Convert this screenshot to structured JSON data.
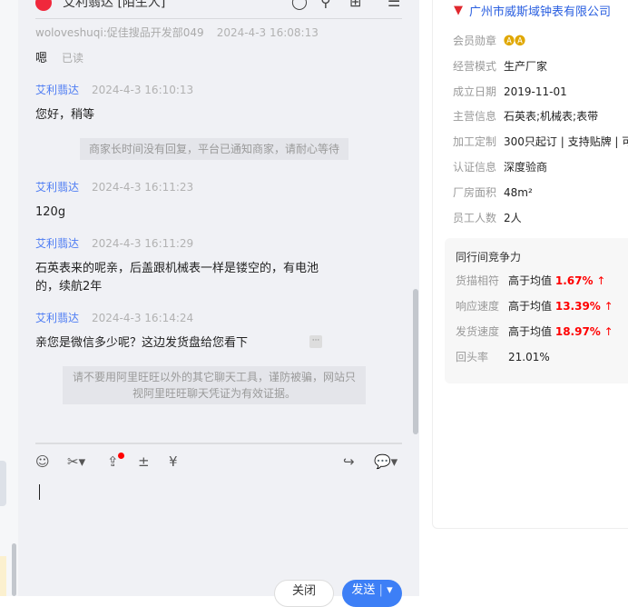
{
  "header": {
    "title": "艾利翡达 [陌生人]"
  },
  "messages": [
    {
      "sender": "woloveshuqi:促佳搜品开发部049",
      "time": "2024-4-3 16:08:13",
      "text": "嗯",
      "status": "已读"
    },
    {
      "sender": "艾利翡达",
      "time": "2024-4-3 16:10:13",
      "text": "您好，稍等"
    },
    {
      "system": "商家长时间没有回复，平台已通知商家，请耐心等待"
    },
    {
      "sender": "艾利翡达",
      "time": "2024-4-3 16:11:23",
      "text": "120g"
    },
    {
      "sender": "艾利翡达",
      "time": "2024-4-3 16:11:29",
      "text": "石英表来的呢亲，后盖跟机械表一样是镂空的，有电池的，续航2年"
    },
    {
      "sender": "艾利翡达",
      "time": "2024-4-3 16:14:24",
      "text": "亲您是微信多少呢？这边发货盘给您看下"
    },
    {
      "system": "请不要用阿里旺旺以外的其它聊天工具，谨防被骗，网站只视阿里旺旺聊天凭证为有效证据。"
    }
  ],
  "composer": {
    "close_label": "关闭",
    "send_label": "发送"
  },
  "company": {
    "name": "广州市威斯域钟表有限公司",
    "rows": [
      {
        "k": "会员勋章",
        "v": "🅐🅐"
      },
      {
        "k": "经营模式",
        "v": "生产厂家"
      },
      {
        "k": "成立日期",
        "v": "2019-11-01"
      },
      {
        "k": "主营信息",
        "v": "石英表;机械表;表带"
      },
      {
        "k": "加工定制",
        "v": "300只起订 | 支持贴牌 | 可"
      },
      {
        "k": "认证信息",
        "v": "深度验商"
      },
      {
        "k": "厂房面积",
        "v": "48m²"
      },
      {
        "k": "员工人数",
        "v": "2人"
      }
    ]
  },
  "competitiveness": {
    "title": "同行间竞争力",
    "rows": [
      {
        "k": "货描相符",
        "v": "高于均值",
        "p": "1.67%",
        "arrow": "↑"
      },
      {
        "k": "响应速度",
        "v": "高于均值",
        "p": "13.39%",
        "arrow": "↑"
      },
      {
        "k": "发货速度",
        "v": "高于均值",
        "p": "18.97%",
        "arrow": "↑"
      }
    ],
    "repeat": {
      "k": "回头率",
      "v": "21.01%"
    }
  }
}
